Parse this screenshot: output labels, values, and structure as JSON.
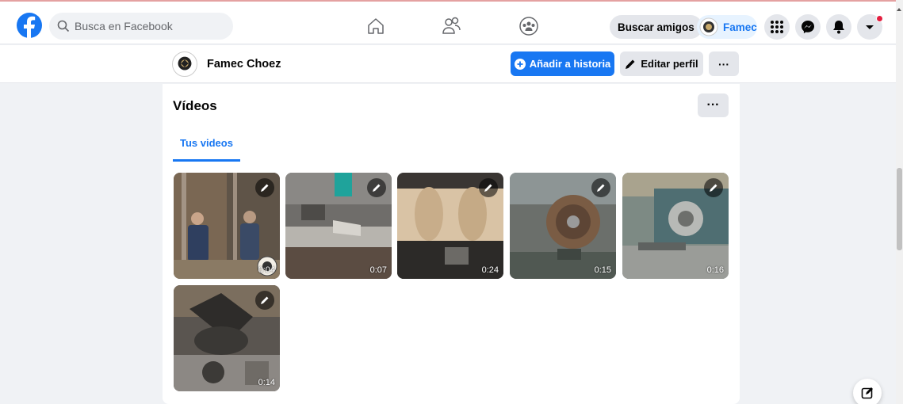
{
  "nav": {
    "search_placeholder": "Busca en Facebook",
    "find_friends_label": "Buscar amigos",
    "profile_short_name": "Famec",
    "icons": [
      "facebook-logo",
      "home-icon",
      "friends-icon",
      "groups-icon",
      "menu-grid-icon",
      "messenger-icon",
      "bell-icon",
      "account-caret-icon"
    ]
  },
  "profile_bar": {
    "name": "Famec Choez",
    "add_story_label": "Añadir a historia",
    "edit_profile_label": "Editar perfil",
    "more_label": "···"
  },
  "videos": {
    "title": "Vídeos",
    "more_label": "···",
    "tab_label": "Tus videos",
    "items": [
      {
        "duration": "0:04"
      },
      {
        "duration": "0:07"
      },
      {
        "duration": "0:24"
      },
      {
        "duration": "0:15"
      },
      {
        "duration": "0:16"
      },
      {
        "duration": "0:14"
      }
    ]
  },
  "colors": {
    "brand": "#1877f2",
    "background": "#f0f2f5",
    "button_gray": "#e4e6eb",
    "notification": "#e41e3f"
  }
}
